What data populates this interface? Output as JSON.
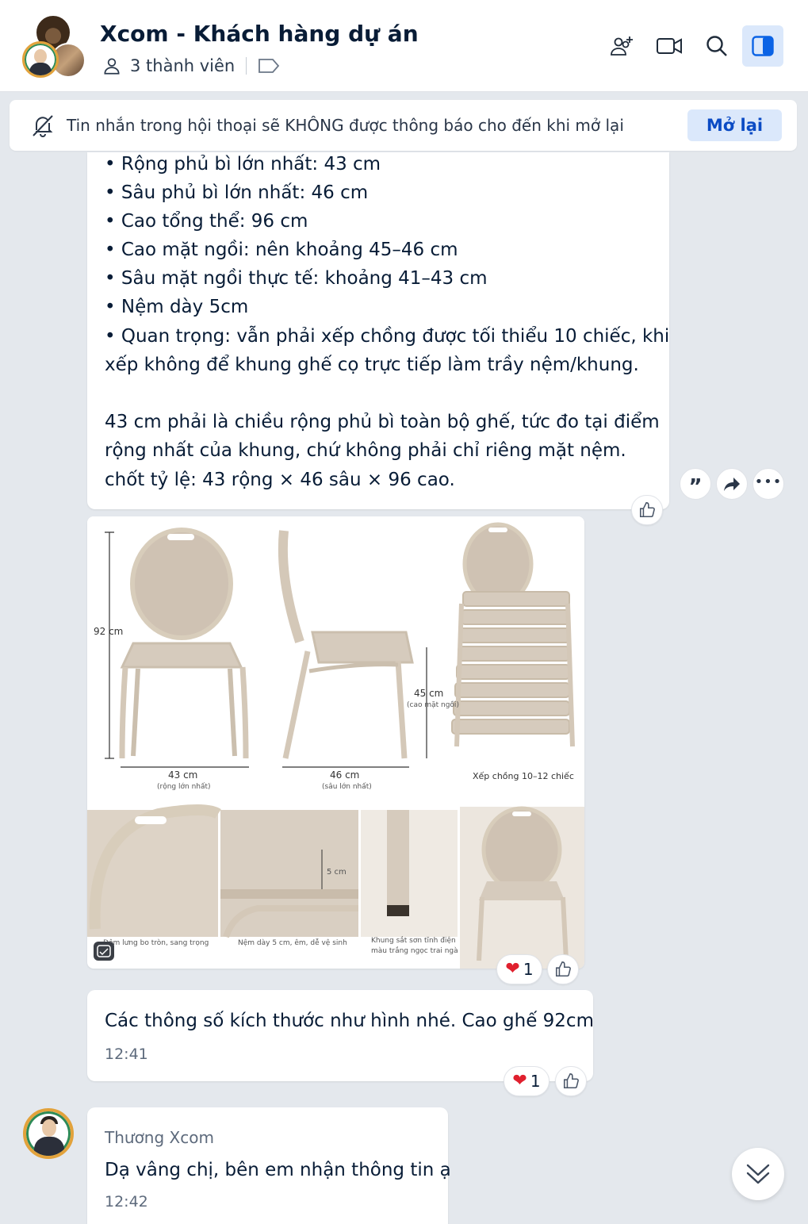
{
  "header": {
    "title": "Xcom - Khách hàng dự án",
    "members": "3 thành viên",
    "icons": [
      "add-member-icon",
      "video-call-icon",
      "search-icon",
      "sidebar-toggle-icon"
    ]
  },
  "notice": {
    "text": "Tin nhắn trong hội thoại sẽ KHÔNG được thông báo cho đến khi mở lại",
    "button": "Mở lại"
  },
  "message1": {
    "lines": [
      "• Rộng phủ bì lớn nhất: 43 cm",
      "• Sâu phủ bì lớn nhất: 46 cm",
      "• Cao tổng thể: 96 cm",
      "• Cao mặt ngồi: nên khoảng 45–46 cm",
      "• Sâu mặt ngồi thực tế: khoảng 41–43 cm",
      "• Nệm dày 5cm",
      "• Quan trọng: vẫn phải xếp chồng được tối thiểu 10 chiếc, khi",
      "xếp không để khung ghế cọ trực tiếp làm trầy nệm/khung.",
      "",
      "43 cm phải là chiều rộng phủ bì toàn bộ ghế, tức đo tại điểm",
      "rộng nhất của khung, chứ không phải chỉ riêng mặt nệm.",
      "chốt tỷ lệ: 43 rộng × 46 sâu × 96 cao."
    ]
  },
  "image": {
    "label_height": "92 cm",
    "label_width": "43 cm",
    "label_width_note": "(rộng lớn nhất)",
    "label_depth": "46 cm",
    "label_depth_note": "(sâu lớn nhất)",
    "label_seat": "45 cm",
    "label_seat_note": "(cao mặt ngồi)",
    "label_stack": "Xếp chồng 10–12 chiếc",
    "label_cushion": "5 cm",
    "caption_back": "Đệm lưng bo tròn, sang trọng",
    "caption_cushion": "Nệm dày 5 cm, êm, dễ vệ sinh",
    "caption_frame_1": "Khung sắt sơn tĩnh điện",
    "caption_frame_2": "màu trắng ngọc trai ngà",
    "reaction_count": "1"
  },
  "message3": {
    "text": "Các thông số kích thước như hình nhé. Cao ghế 92cm",
    "time": "12:41",
    "reaction_count": "1"
  },
  "message4": {
    "sender": "Thương Xcom",
    "text": "Dạ vâng chị, bên em nhận thông tin ạ",
    "time": "12:42"
  },
  "colors": {
    "accent": "#0b4bc4",
    "accent_bg": "#dbe8fb",
    "background": "#e4e8ed",
    "heart": "#e0202e"
  }
}
